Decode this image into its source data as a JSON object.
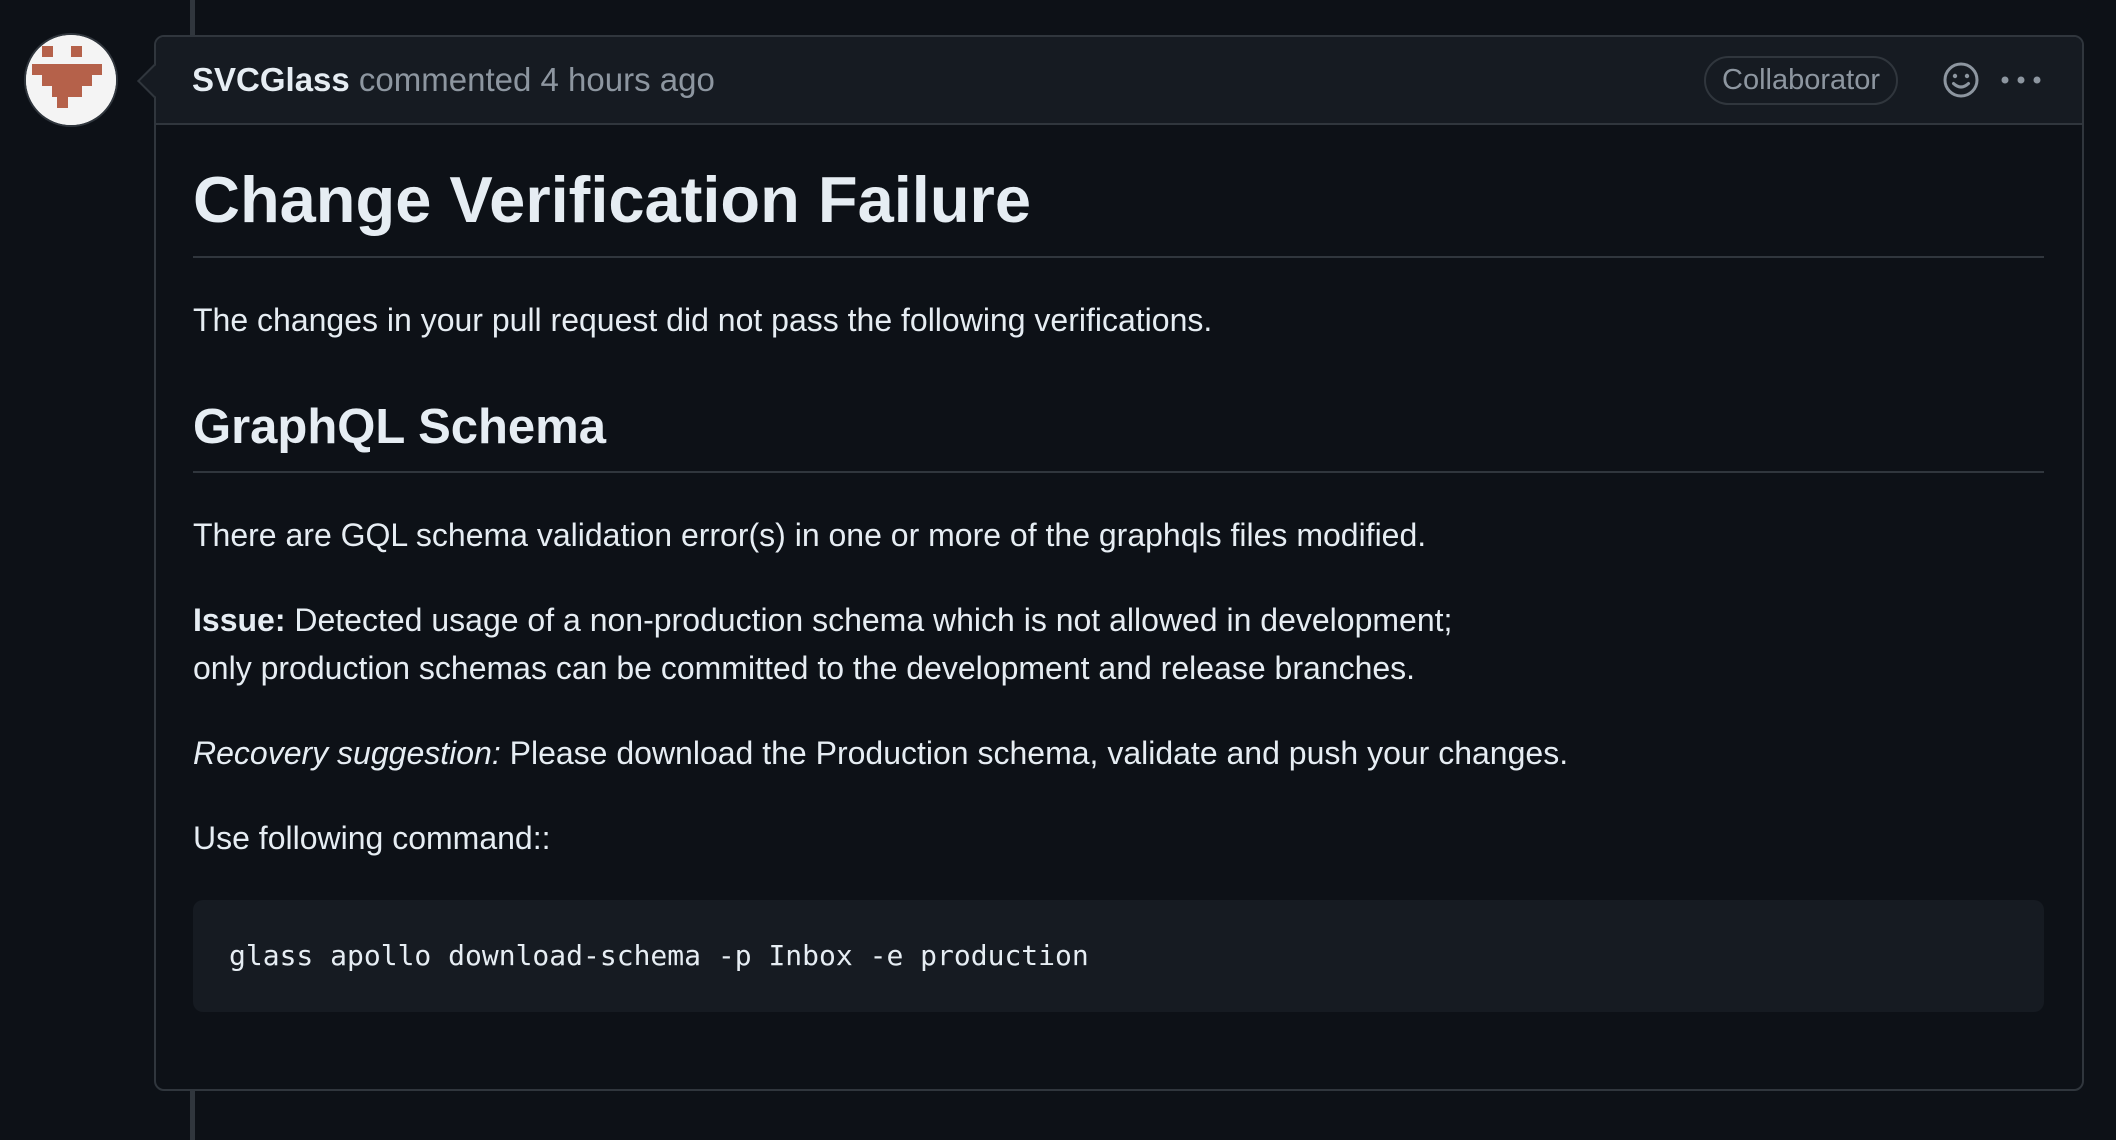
{
  "comment": {
    "author": "SVCGlass",
    "action": "commented",
    "time": "4 hours ago",
    "badge": "Collaborator",
    "icons": {
      "reaction": "smiley-icon",
      "menu": "kebab-menu-icon"
    }
  },
  "body": {
    "title": "Change Verification Failure",
    "intro": "The changes in your pull request did not pass the following verifications.",
    "section_title": "GraphQL Schema",
    "section_text": "There are GQL schema validation error(s) in one or more of the graphqls files modified.",
    "issue_label": "Issue:",
    "issue_text_line1": "Detected usage of a non-production schema which is not allowed in development;",
    "issue_text_line2": "only production schemas can be committed to the development and release branches.",
    "recovery_label": "Recovery suggestion:",
    "recovery_text": "Please download the Production schema, validate and push your changes.",
    "command_intro": "Use following command::",
    "command": "glass apollo download-schema -p Inbox -e production"
  },
  "colors": {
    "background": "#0d1117",
    "header_bg": "#161b22",
    "border": "#30363d",
    "text": "#e6edf3",
    "muted": "#8d96a0",
    "avatar_pattern": "#b5614a"
  }
}
